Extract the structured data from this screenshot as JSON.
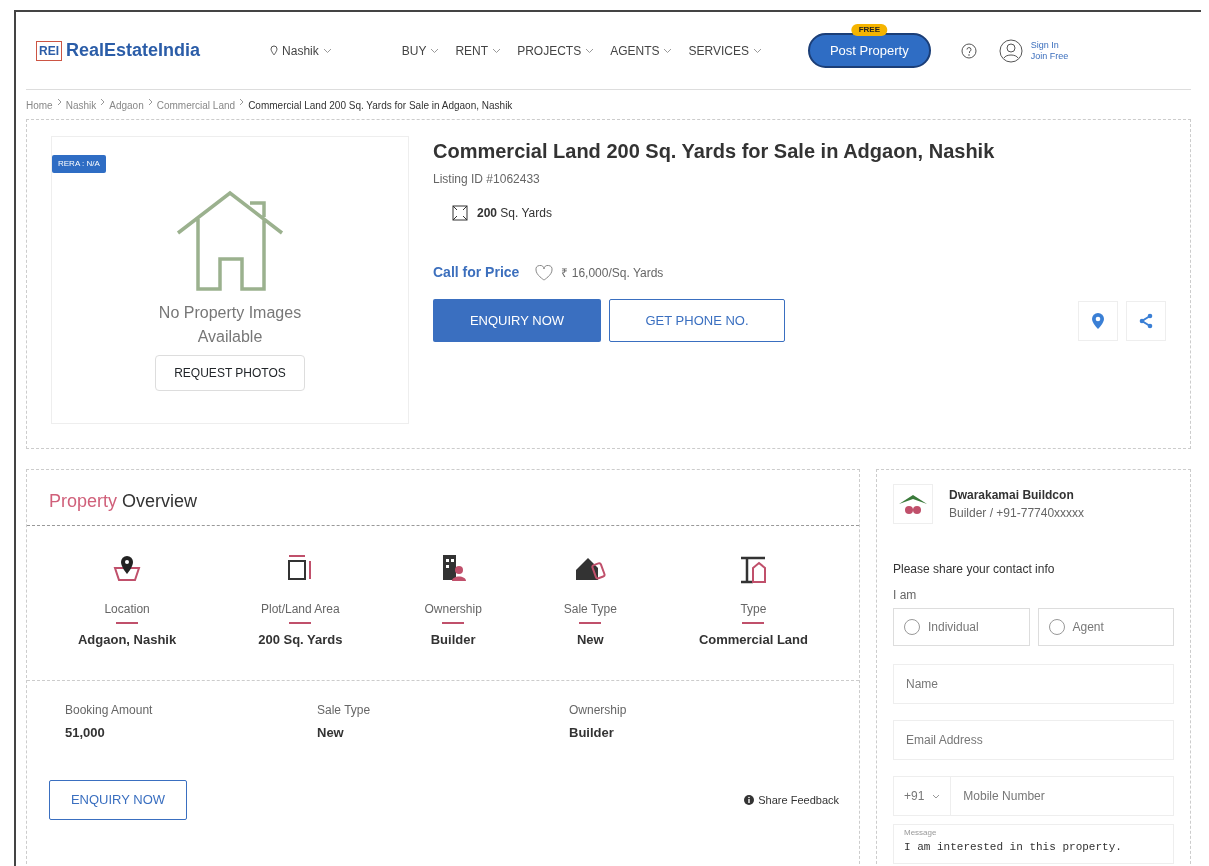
{
  "header": {
    "logo_mark": "REI",
    "logo_text": "RealEstateIndia",
    "city": "Nashik",
    "nav": [
      {
        "label": "BUY"
      },
      {
        "label": "RENT"
      },
      {
        "label": "PROJECTS"
      },
      {
        "label": "AGENTS"
      },
      {
        "label": "SERVICES"
      }
    ],
    "post_button": "Post Property",
    "post_badge": "FREE",
    "sign_in": "Sign In",
    "join": "Join Free"
  },
  "breadcrumb": [
    "Home",
    "Nashik",
    "Adgaon",
    "Commercial Land",
    "Commercial Land 200 Sq. Yards for Sale in Adgaon, Nashik"
  ],
  "listing": {
    "rera": "RERA : N/A",
    "no_images": "No Property Images Available",
    "request_button": "REQUEST PHOTOS",
    "title": "Commercial Land 200 Sq. Yards for Sale in Adgaon, Nashik",
    "listing_id": "Listing ID #1062433",
    "area_value": "200",
    "area_unit": "Sq. Yards",
    "price": "Call for Price",
    "rate": "₹ 16,000/Sq. Yards",
    "enquiry_button": "ENQUIRY NOW",
    "phone_button": "GET PHONE NO."
  },
  "overview": {
    "title_lead": "Property",
    "title_rest": "Overview",
    "features": [
      {
        "kind": "location",
        "label": "Location",
        "value": "Adgaon, Nashik"
      },
      {
        "kind": "area",
        "label": "Plot/Land Area",
        "value": "200 Sq. Yards"
      },
      {
        "kind": "ownership",
        "label": "Ownership",
        "value": "Builder"
      },
      {
        "kind": "sale",
        "label": "Sale Type",
        "value": "New"
      },
      {
        "kind": "type",
        "label": "Type",
        "value": "Commercial Land"
      }
    ],
    "details": [
      {
        "label": "Booking Amount",
        "value": "51,000"
      },
      {
        "label": "Sale Type",
        "value": "New"
      },
      {
        "label": "Ownership",
        "value": "Builder"
      }
    ],
    "enquiry_button": "ENQUIRY NOW",
    "feedback": "Share Feedback"
  },
  "contact": {
    "name": "Dwarakamai Buildcon",
    "role": "Builder / +91-77740xxxxx",
    "prompt": "Please share your contact info",
    "iam": "I am",
    "roles": [
      {
        "label": "Individual",
        "selected": false
      },
      {
        "label": "Agent",
        "selected": false
      }
    ],
    "name_placeholder": "Name",
    "email_placeholder": "Email Address",
    "code": "+91",
    "mobile_placeholder": "Mobile Number",
    "message_label": "Message",
    "message": "I am interested in this property."
  }
}
